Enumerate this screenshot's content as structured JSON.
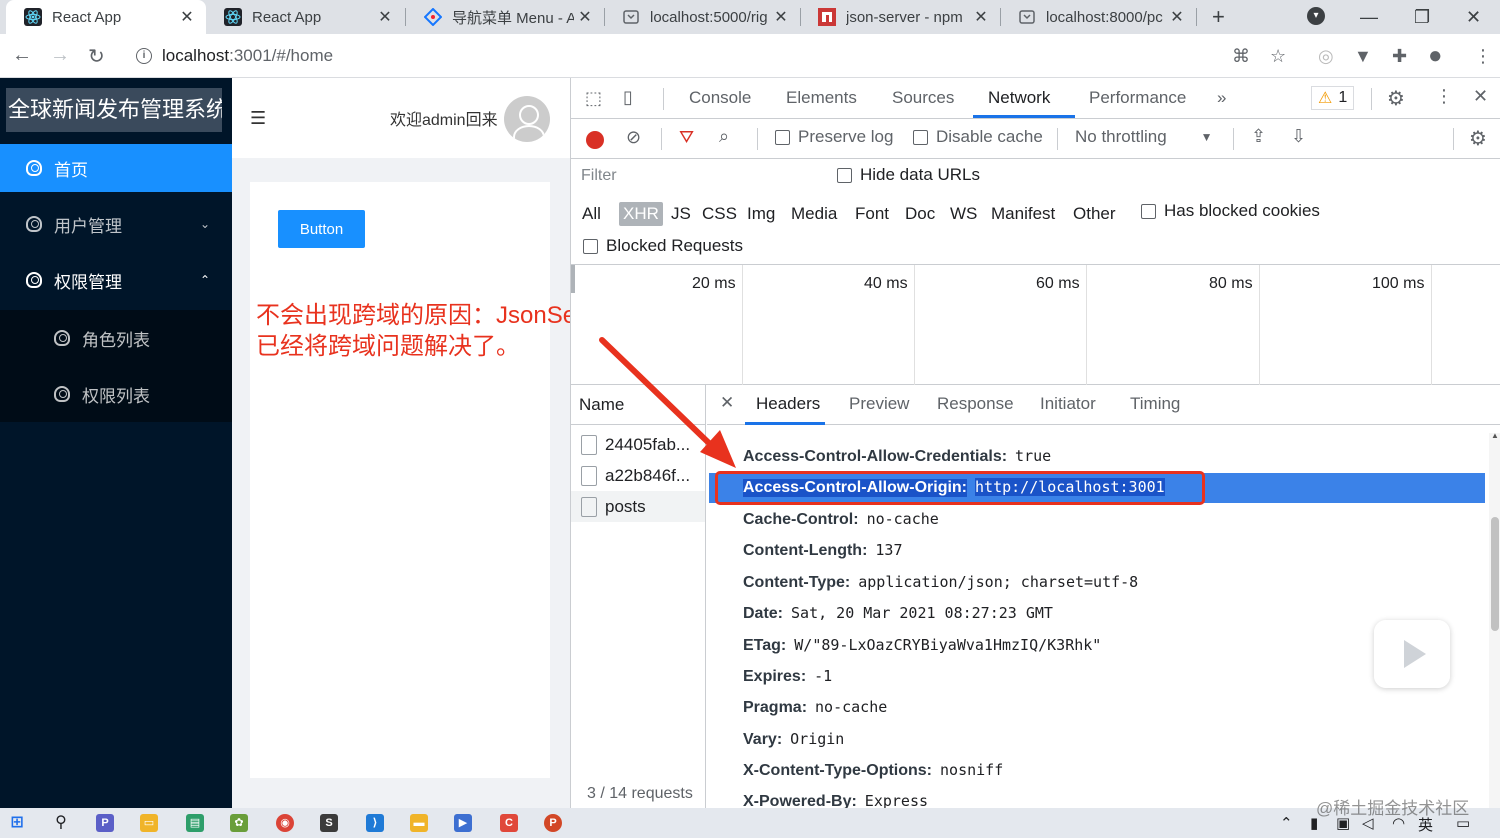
{
  "browser": {
    "tabs": [
      {
        "title": "React App",
        "icon": "react-icon",
        "active": true
      },
      {
        "title": "React App",
        "icon": "react-icon",
        "active": false
      },
      {
        "title": "导航菜单 Menu - A",
        "icon": "ant-design-icon",
        "active": false
      },
      {
        "title": "localhost:5000/rig",
        "icon": "page-icon",
        "active": false
      },
      {
        "title": "json-server - npm",
        "icon": "npm-icon",
        "active": false
      },
      {
        "title": "localhost:8000/pc",
        "icon": "page-icon",
        "active": false
      }
    ],
    "url_host": "localhost",
    "url_rest": ":3001/#/home"
  },
  "app": {
    "logo": "全球新闻发布管理系统",
    "menu": [
      {
        "label": "首页"
      },
      {
        "label": "用户管理"
      },
      {
        "label": "权限管理"
      },
      {
        "label": "角色列表"
      },
      {
        "label": "权限列表"
      }
    ],
    "welcome": "欢迎admin回来",
    "button_label": "Button",
    "annotation_line1": "不会出现跨域的原因：JsonServer",
    "annotation_line2": "已经将跨域问题解决了。"
  },
  "devtools": {
    "tabs": [
      "Console",
      "Elements",
      "Sources",
      "Network",
      "Performance"
    ],
    "active_tab": "Network",
    "warning_count": "1",
    "preserve_log": "Preserve log",
    "disable_cache": "Disable cache",
    "throttling": "No throttling",
    "filter_placeholder": "Filter",
    "hide_data_urls": "Hide data URLs",
    "types": [
      "All",
      "XHR",
      "JS",
      "CSS",
      "Img",
      "Media",
      "Font",
      "Doc",
      "WS",
      "Manifest",
      "Other"
    ],
    "active_type": "XHR",
    "has_blocked_cookies": "Has blocked cookies",
    "blocked_requests": "Blocked Requests",
    "timeline_labels": [
      "20 ms",
      "40 ms",
      "60 ms",
      "80 ms",
      "100 ms"
    ],
    "name_header": "Name",
    "requests": [
      "24405fab...",
      "a22b846f...",
      "posts"
    ],
    "request_count": "3 / 14 requests",
    "detail_tabs": [
      "Headers",
      "Preview",
      "Response",
      "Initiator",
      "Timing"
    ],
    "active_detail_tab": "Headers",
    "headers": [
      {
        "key": "Access-Control-Allow-Credentials:",
        "value": "true"
      },
      {
        "key": "Access-Control-Allow-Origin:",
        "value": "http://localhost:3001"
      },
      {
        "key": "Cache-Control:",
        "value": "no-cache"
      },
      {
        "key": "Content-Length:",
        "value": "137"
      },
      {
        "key": "Content-Type:",
        "value": "application/json; charset=utf-8"
      },
      {
        "key": "Date:",
        "value": "Sat, 20 Mar 2021 08:27:23 GMT"
      },
      {
        "key": "ETag:",
        "value": "W/\"89-LxOazCRYBiyaWva1HmzIQ/K3Rhk\""
      },
      {
        "key": "Expires:",
        "value": "-1"
      },
      {
        "key": "Pragma:",
        "value": "no-cache"
      },
      {
        "key": "Vary:",
        "value": "Origin"
      },
      {
        "key": "X-Content-Type-Options:",
        "value": "nosniff"
      },
      {
        "key": "X-Powered-By:",
        "value": "Express"
      }
    ]
  },
  "taskbar": {
    "ime": "英",
    "watermark": "@稀土掘金技术社区"
  },
  "colors": {
    "sidebar_bg": "#001529",
    "selected_menu": "#1890ff",
    "annotation": "#e8321e",
    "highlight_row": "#3b82e8"
  }
}
